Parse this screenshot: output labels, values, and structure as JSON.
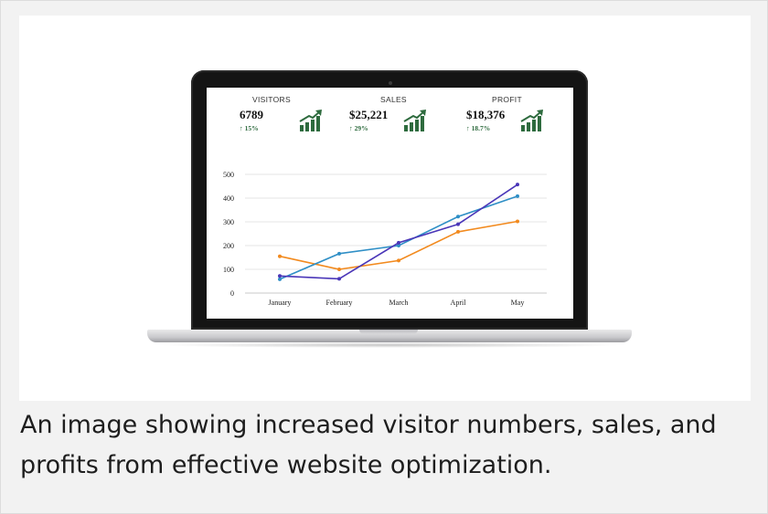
{
  "caption": "An image showing increased visitor numbers, sales, and profits from effective website optimization.",
  "stats": [
    {
      "label": "VISITORS",
      "value": "6789",
      "change": "15%",
      "arrow": "↑"
    },
    {
      "label": "SALES",
      "value": "$25,221",
      "change": "29%",
      "arrow": "↑"
    },
    {
      "label": "PROFIT",
      "value": "$18,376",
      "change": "18.7%",
      "arrow": "↑"
    }
  ],
  "colors": {
    "trend_green": "#2e6b3e",
    "series_orange": "#f28a1e",
    "series_blue": "#2f8fc6",
    "series_purple": "#4a36b8"
  },
  "icons": [
    "growth-chart-icon"
  ],
  "chart_data": {
    "type": "line",
    "categories": [
      "January",
      "February",
      "March",
      "April",
      "May"
    ],
    "yticks": [
      0,
      100,
      200,
      300,
      400,
      500
    ],
    "ylim": [
      0,
      500
    ],
    "grid": true,
    "series": [
      {
        "values": [
          155,
          100,
          137,
          258,
          302
        ],
        "color": "#f28a1e"
      },
      {
        "values": [
          58,
          166,
          200,
          322,
          408
        ],
        "color": "#2f8fc6"
      },
      {
        "values": [
          72,
          60,
          212,
          290,
          457
        ],
        "color": "#4a36b8"
      }
    ]
  }
}
